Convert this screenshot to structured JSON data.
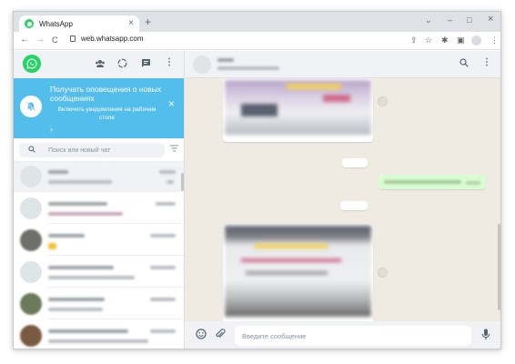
{
  "browser": {
    "tab_title": "WhatsApp",
    "tab_close": "×",
    "new_tab": "+",
    "win_minimize": "–",
    "win_maximize": "□",
    "win_close": "×",
    "win_chevron": "⌄",
    "nav_back": "←",
    "nav_forward": "→",
    "nav_reload": "C",
    "url": "web.whatsapp.com"
  },
  "notification": {
    "title": "Получать оповещения о новых сообщениях",
    "subtitle": "Включить уведомления на рабочем столе",
    "arrow": "›",
    "close": "×"
  },
  "search": {
    "placeholder": "Поиск или новый чат"
  },
  "composer": {
    "placeholder": "Введите сообщение"
  },
  "colors": {
    "accent": "#25d366",
    "banner": "#53bdeb",
    "chat_bg": "#efeae2",
    "outgoing": "#d9fdd3"
  }
}
